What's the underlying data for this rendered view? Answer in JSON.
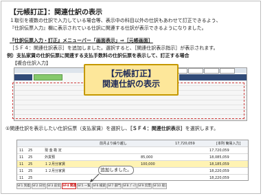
{
  "title": "【元帳訂正】：関連仕訳の表示",
  "intro": {
    "line1": "１取引を複数の仕訳で入力している場合等、表示中の科目以外の仕訳もあわせて訂正できるよう、",
    "line2": "『仕訳伝票入力』欄に表示されている仕訳に関連する仕訳が表示できるようになりました。"
  },
  "menu_path": "『仕訳伝票入力・訂正』メニューバー「画面表示」⇒［元帳画面］",
  "sf4_note": "［ＳＦ４：関連仕訳表示］を追加しました。選択すると、［関連仕訳表示指示］が表示されます。",
  "example": "例）支払家賃の仕訳伝票に関連する支払手数料の仕訳伝票を表示して、訂正する場合",
  "composite_label": "【複合仕訳入力】",
  "callout": {
    "line1": "【元帳訂正】",
    "line2": "関連仕訳の表示"
  },
  "step1": {
    "prefix": "①関連仕訳を表示したい仕訳伝票（支払家賃）を選択し、",
    "key": "［ＳＦ４：関連仕訳表示］",
    "suffix": "を選択します。"
  },
  "screen2": {
    "header": "前月より繰り越し",
    "header_amount": "17,720,059",
    "ledger_label": "[本則 簡易入力]",
    "rows": [
      {
        "date": "11",
        "month": "25",
        "desc": "現 金 勘 定",
        "amt1": "",
        "amt2": "17,720,059"
      },
      {
        "date": "11",
        "month": "25",
        "desc": "外貨預",
        "amt1": "85,000",
        "amt2": "18,085,059"
      },
      {
        "date": "11",
        "month": "25",
        "desc": "１２月分家賃",
        "amt1": "100,000",
        "amt2": "18,185,059"
      },
      {
        "date": "11",
        "month": "25",
        "desc": "１２月分家賃",
        "amt1": "",
        "amt2": "18,220,059"
      },
      {
        "date": "11",
        "month": "25",
        "desc": "",
        "amt1": "",
        "amt2": "18,220,059"
      }
    ]
  },
  "bubble": "追加しました。",
  "fkeys": [
    "SF1 到着通知",
    "SF2 日付入力",
    "SF3 前伝票指定",
    "SF4 関連仕訳",
    "SF5 一覧表示",
    "SF6 検索指定",
    "SF7 部門別表示",
    "SF8 ﾌﾞｯｸ入力",
    "SF9 伝票訂正",
    "SF10 取消"
  ],
  "fkey_highlight_index": 3
}
